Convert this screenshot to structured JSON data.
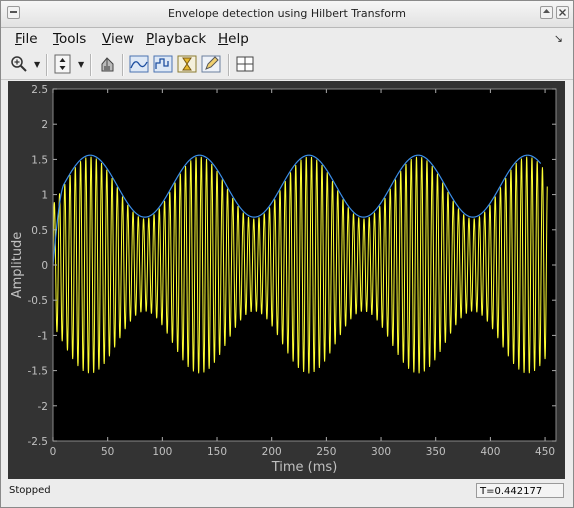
{
  "window": {
    "title": "Envelope detection using Hilbert Transform"
  },
  "menu": [
    {
      "label": "File",
      "u": "F",
      "rest": "ile"
    },
    {
      "label": "Tools",
      "u": "T",
      "rest": "ools"
    },
    {
      "label": "View",
      "u": "V",
      "rest": "iew"
    },
    {
      "label": "Playback",
      "u": "P",
      "rest": "layback"
    },
    {
      "label": "Help",
      "u": "H",
      "rest": "elp"
    }
  ],
  "toolbar": {
    "icons": [
      "zoom-in-icon",
      "dropdown-arrow-icon",
      "scale-axes-icon",
      "dropdown-arrow-icon",
      "highlight-icon",
      "view-mode-1-icon",
      "view-mode-2-icon",
      "view-mode-3-icon",
      "edit-icon",
      "grid-layout-icon"
    ]
  },
  "colors": {
    "signal": "#ffff33",
    "envelope": "#3b8ee8",
    "axes_bg": "#000000",
    "figure_bg": "#333333",
    "axis_text": "#c0c0c0"
  },
  "chart_data": {
    "type": "line",
    "xlabel": "Time (ms)",
    "ylabel": "Amplitude",
    "xlim": [
      0,
      460
    ],
    "ylim": [
      -2.5,
      2.5
    ],
    "xticks": [
      0,
      50,
      100,
      150,
      200,
      250,
      300,
      350,
      400,
      450
    ],
    "yticks": [
      -2.5,
      -2,
      -1.5,
      -1,
      -0.5,
      0,
      0.5,
      1,
      1.5,
      2,
      2.5
    ],
    "grid": false,
    "series": [
      {
        "role": "signal",
        "x_range": [
          0,
          452
        ],
        "modulation_mean": 1.1,
        "modulation_amplitude": 0.44,
        "modulation_period_ms": 100,
        "envelope_peak_ms": 34,
        "carrier_period_ms": 4.8
      },
      {
        "role": "envelope",
        "x_range": [
          0,
          446
        ],
        "peak": 1.56,
        "trough": 0.68,
        "period_ms": 100,
        "first_peak_ms": 34
      }
    ]
  },
  "status": {
    "text": "Stopped",
    "time": "T=0.442177"
  }
}
